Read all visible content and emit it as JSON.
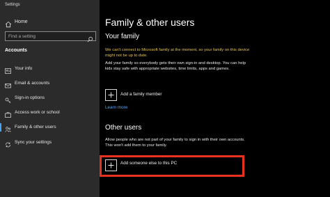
{
  "window": {
    "title": "Settings"
  },
  "sidebar": {
    "home_label": "Home",
    "search_placeholder": "Find a setting",
    "section_label": "Accounts",
    "items": [
      {
        "label": "Your info",
        "icon": "person-card-icon"
      },
      {
        "label": "Email & accounts",
        "icon": "mail-icon"
      },
      {
        "label": "Sign-in options",
        "icon": "key-icon"
      },
      {
        "label": "Access work or school",
        "icon": "briefcase-icon"
      },
      {
        "label": "Family & other users",
        "icon": "family-icon",
        "active": true
      },
      {
        "label": "Sync your settings",
        "icon": "sync-icon"
      }
    ]
  },
  "main": {
    "title": "Family & other users",
    "your_family": {
      "heading": "Your family",
      "warning": "We can't connect to Microsoft family at the moment, so your family on this device might not be up to date.",
      "description": "Add your family so everybody gets their own sign-in and desktop. You can help kids stay safe with appropriate websites, time limits, apps and games.",
      "add_label": "Add a family member",
      "link": "Learn more"
    },
    "other_users": {
      "heading": "Other users",
      "description": "Allow people who are not part of your family to sign in with their own accounts. This won't add them to your family.",
      "add_label": "Add someone else to this PC"
    }
  },
  "colors": {
    "accent": "#4aa3f0",
    "warning": "#e6c44a",
    "link": "#5da2e6",
    "highlight": "#e8321f",
    "sidebar_bg": "#2b2b2b"
  }
}
